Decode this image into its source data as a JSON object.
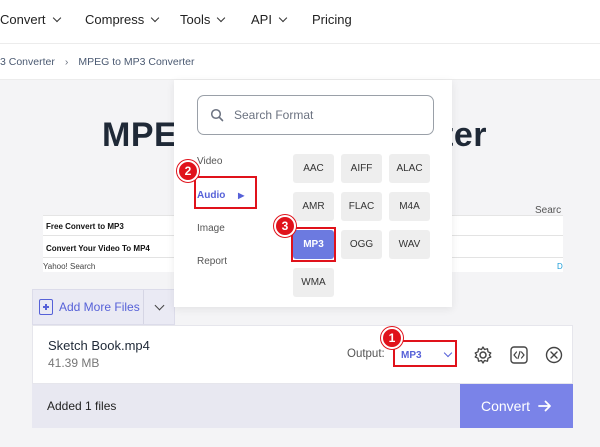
{
  "nav": {
    "items": [
      {
        "label": "Convert"
      },
      {
        "label": "Compress"
      },
      {
        "label": "Tools"
      },
      {
        "label": "API"
      },
      {
        "label": "Pricing"
      }
    ]
  },
  "breadcrumb": {
    "items": [
      "3 Converter",
      "MPEG to MP3 Converter"
    ]
  },
  "title": {
    "left": "MPE",
    "right": "ter"
  },
  "ad": {
    "rows": [
      "Free Convert to MP3",
      "Convert Your Video To MP4"
    ],
    "footer": "Yahoo! Search",
    "search_label": "Searc",
    "mark": "D"
  },
  "add_files": {
    "label": "Add More Files"
  },
  "file": {
    "name": "Sketch Book.mp4",
    "size": "41.39 MB",
    "output_label": "Output:",
    "output_value": "MP3"
  },
  "bottom": {
    "status": "Added 1 files",
    "convert_label": "Convert"
  },
  "format_panel": {
    "search_placeholder": "Search Format",
    "categories": [
      "Video",
      "Audio",
      "Image",
      "Report"
    ],
    "formats": [
      "AAC",
      "AIFF",
      "ALAC",
      "AMR",
      "FLAC",
      "M4A",
      "MP3",
      "OGG",
      "WAV",
      "WMA"
    ],
    "selected_format": "MP3",
    "active_category": "Audio"
  },
  "annotations": {
    "badges": [
      "1",
      "2",
      "3"
    ],
    "color": "#e0121b"
  },
  "colors": {
    "accent": "#5661d8",
    "convert_button": "#7a83e8",
    "selected_format": "#6c7ae0"
  }
}
